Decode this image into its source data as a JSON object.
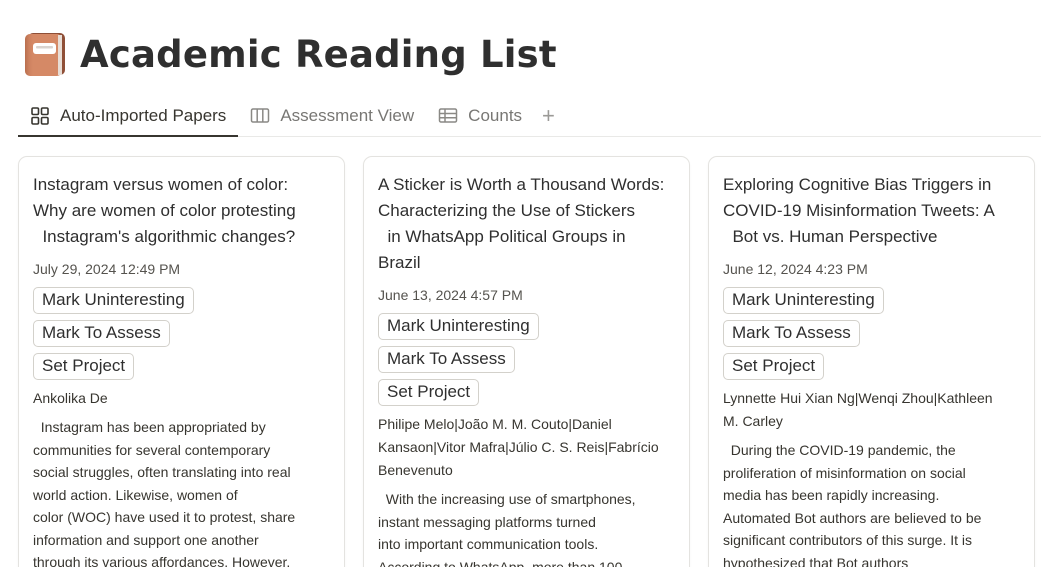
{
  "page": {
    "title": "Academic Reading List",
    "icon": "book-icon"
  },
  "tabs": [
    {
      "label": "Auto-Imported Papers",
      "icon": "gallery-icon",
      "active": true
    },
    {
      "label": "Assessment View",
      "icon": "board-icon",
      "active": false
    },
    {
      "label": "Counts",
      "icon": "table-icon",
      "active": false
    }
  ],
  "add_tab_label": "+",
  "cards": [
    {
      "title": "Instagram versus women of color:\nWhy are women of color protesting\n  Instagram's algorithmic changes?",
      "date": "July 29, 2024 12:49 PM",
      "buttons": {
        "uninteresting": "Mark Uninteresting",
        "assess": "Mark To Assess",
        "project": "Set Project"
      },
      "authors": "Ankolika De",
      "abstract": "  Instagram has been appropriated by\ncommunities for several contemporary\nsocial struggles, often translating into real\nworld action. Likewise, women of\ncolor (WOC) have used it to protest, share\ninformation and support one another\nthrough its various affordances. However,"
    },
    {
      "title": "A Sticker is Worth a Thousand Words:\nCharacterizing the Use of Stickers\n  in WhatsApp Political Groups in\nBrazil",
      "date": "June 13, 2024 4:57 PM",
      "buttons": {
        "uninteresting": "Mark Uninteresting",
        "assess": "Mark To Assess",
        "project": "Set Project"
      },
      "authors": "Philipe Melo|João M. M. Couto|Daniel\nKansaon|Vitor Mafra|Júlio C. S. Reis|Fabrício\nBenevenuto",
      "abstract": "  With the increasing use of smartphones,\ninstant messaging platforms turned\ninto important communication tools.\nAccording to WhatsApp, more than 100"
    },
    {
      "title": "Exploring Cognitive Bias Triggers in\nCOVID-19 Misinformation Tweets: A\n  Bot vs. Human Perspective",
      "date": "June 12, 2024 4:23 PM",
      "buttons": {
        "uninteresting": "Mark Uninteresting",
        "assess": "Mark To Assess",
        "project": "Set Project"
      },
      "authors": "Lynnette Hui Xian Ng|Wenqi Zhou|Kathleen\nM. Carley",
      "abstract": "  During the COVID-19 pandemic, the\nproliferation of misinformation on social\nmedia has been rapidly increasing.\nAutomated Bot authors are believed to be\nsignificant contributors of this surge. It is\nhypothesized that Bot authors"
    }
  ],
  "colors": {
    "text": "#37352f",
    "muted": "#787774",
    "border": "#e4e3e0",
    "book": "#c97b5a"
  }
}
